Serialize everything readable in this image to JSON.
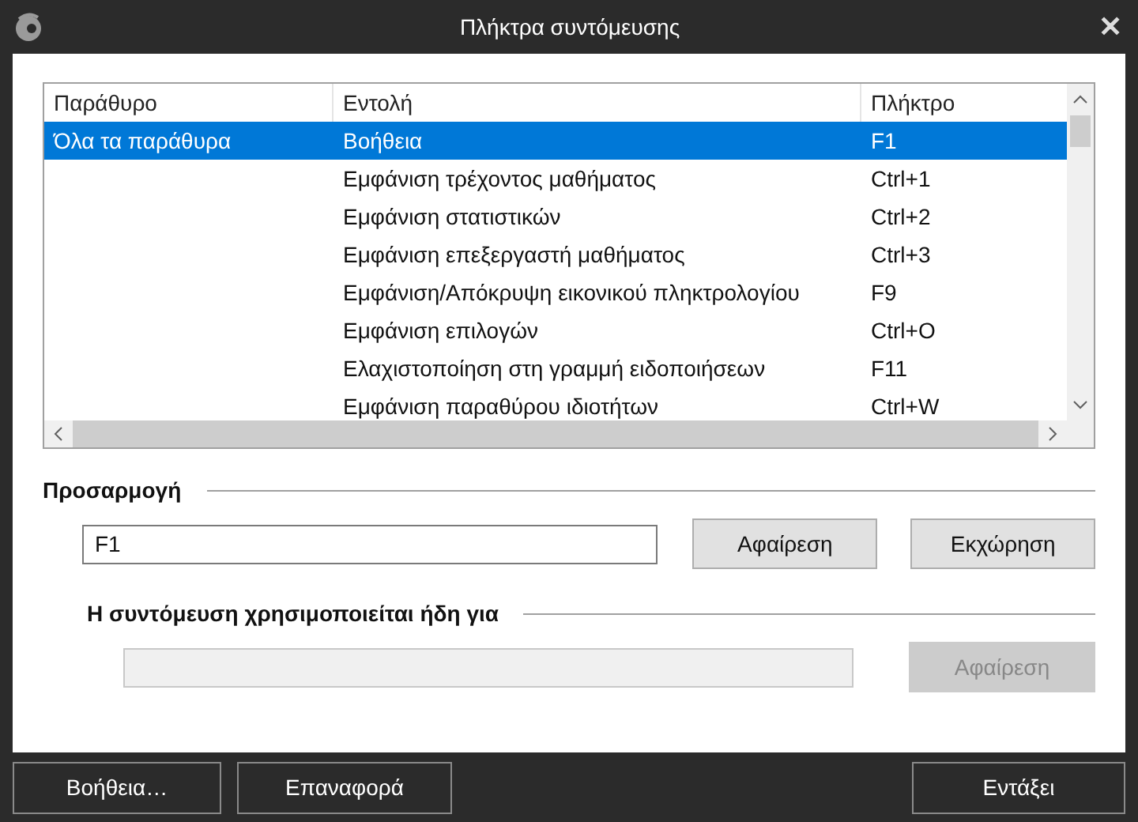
{
  "window": {
    "title": "Πλήκτρα συντόμευσης",
    "close": "✕"
  },
  "table": {
    "columns": [
      "Παράθυρο",
      "Εντολή",
      "Πλήκτρο"
    ],
    "rows": [
      {
        "window": "Όλα τα παράθυρα",
        "command": "Βοήθεια",
        "key": "F1",
        "selected": true
      },
      {
        "command": "Εμφάνιση τρέχοντος μαθήματος",
        "key": "Ctrl+1",
        "selected": false
      },
      {
        "command": "Εμφάνιση στατιστικών",
        "key": "Ctrl+2",
        "selected": false
      },
      {
        "command": "Εμφάνιση επεξεργαστή μαθήματος",
        "key": "Ctrl+3",
        "selected": false
      },
      {
        "command": "Εμφάνιση/Απόκρυψη εικονικού πληκτρολογίου",
        "key": "F9",
        "selected": false
      },
      {
        "command": "Εμφάνιση επιλογών",
        "key": "Ctrl+O",
        "selected": false
      },
      {
        "command": "Ελαχιστοποίηση στη γραμμή ειδοποιήσεων",
        "key": "F11",
        "selected": false
      },
      {
        "command": "Εμφάνιση παραθύρου ιδιοτήτων",
        "key": "Ctrl+W",
        "selected": false
      }
    ]
  },
  "customize": {
    "heading": "Προσαρμογή",
    "value": "F1",
    "buttons": [
      {
        "label": "Αφαίρεση",
        "disabled": false
      },
      {
        "label": "Εκχώρηση",
        "disabled": false
      }
    ]
  },
  "conflict": {
    "heading": "Η συντόμευση χρησιμοποιείται ήδη για",
    "field_disabled": true,
    "button": {
      "label": "Αφαίρεση",
      "disabled": true
    }
  },
  "footer": {
    "left_buttons": [
      "Βοήθεια…",
      "Επαναφορά"
    ],
    "right_buttons": [
      "Εντάξει"
    ]
  }
}
